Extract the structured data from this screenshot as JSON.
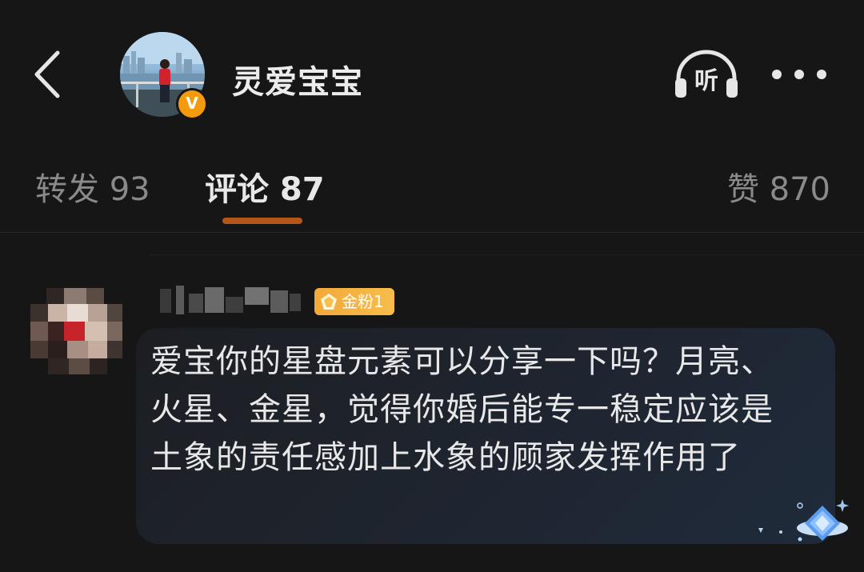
{
  "header": {
    "username": "灵爱宝宝",
    "verified_badge": "V",
    "listen_label": "听",
    "icons": {
      "back": "chevron-left-icon",
      "listen": "headphones-icon",
      "more": "more-dots-icon"
    }
  },
  "tabs": [
    {
      "label": "转发 93",
      "active": false
    },
    {
      "label": "评论 87",
      "active": true
    },
    {
      "label": "赞 870",
      "active": false
    }
  ],
  "comment": {
    "badge": "金粉1",
    "text": "爱宝你的星盘元素可以分享一下吗？月亮、火星、金星，觉得你婚后能专一稳定应该是土象的责任感加上水象的顾家发挥作用了"
  },
  "colors": {
    "background": "#161616",
    "accent": "#b4561a",
    "badge_gold": "#f3a93a",
    "verified": "#f39a0e"
  }
}
